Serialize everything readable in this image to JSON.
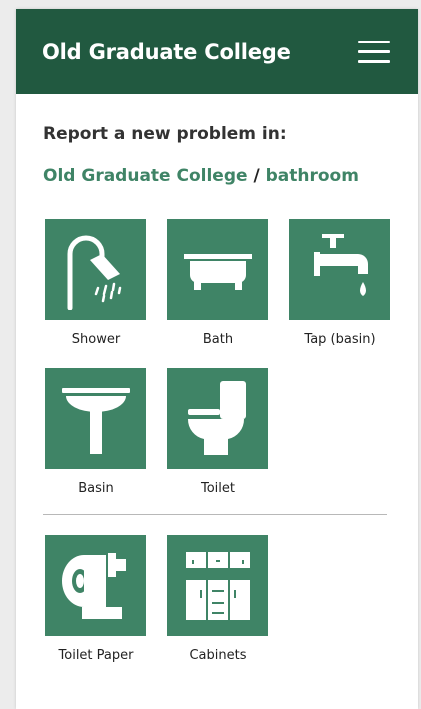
{
  "header": {
    "title": "Old Graduate College",
    "menu_icon": "hamburger-menu-icon"
  },
  "report": {
    "lead": "Report a new problem in:",
    "breadcrumb": {
      "location": "Old Graduate College",
      "separator": " / ",
      "room": "bathroom"
    }
  },
  "categories": [
    {
      "label": "Shower",
      "icon": "shower-icon"
    },
    {
      "label": "Bath",
      "icon": "bathtub-icon"
    },
    {
      "label": "Tap (basin)",
      "icon": "tap-icon"
    },
    {
      "label": "Basin",
      "icon": "basin-icon"
    },
    {
      "label": "Toilet",
      "icon": "toilet-icon"
    }
  ],
  "extra_categories": [
    {
      "label": "Toilet Paper",
      "icon": "toilet-paper-icon"
    },
    {
      "label": "Cabinets",
      "icon": "cabinets-icon"
    }
  ],
  "colors": {
    "header": "#215940",
    "tile": "#3f8466",
    "link": "#3f8466"
  }
}
